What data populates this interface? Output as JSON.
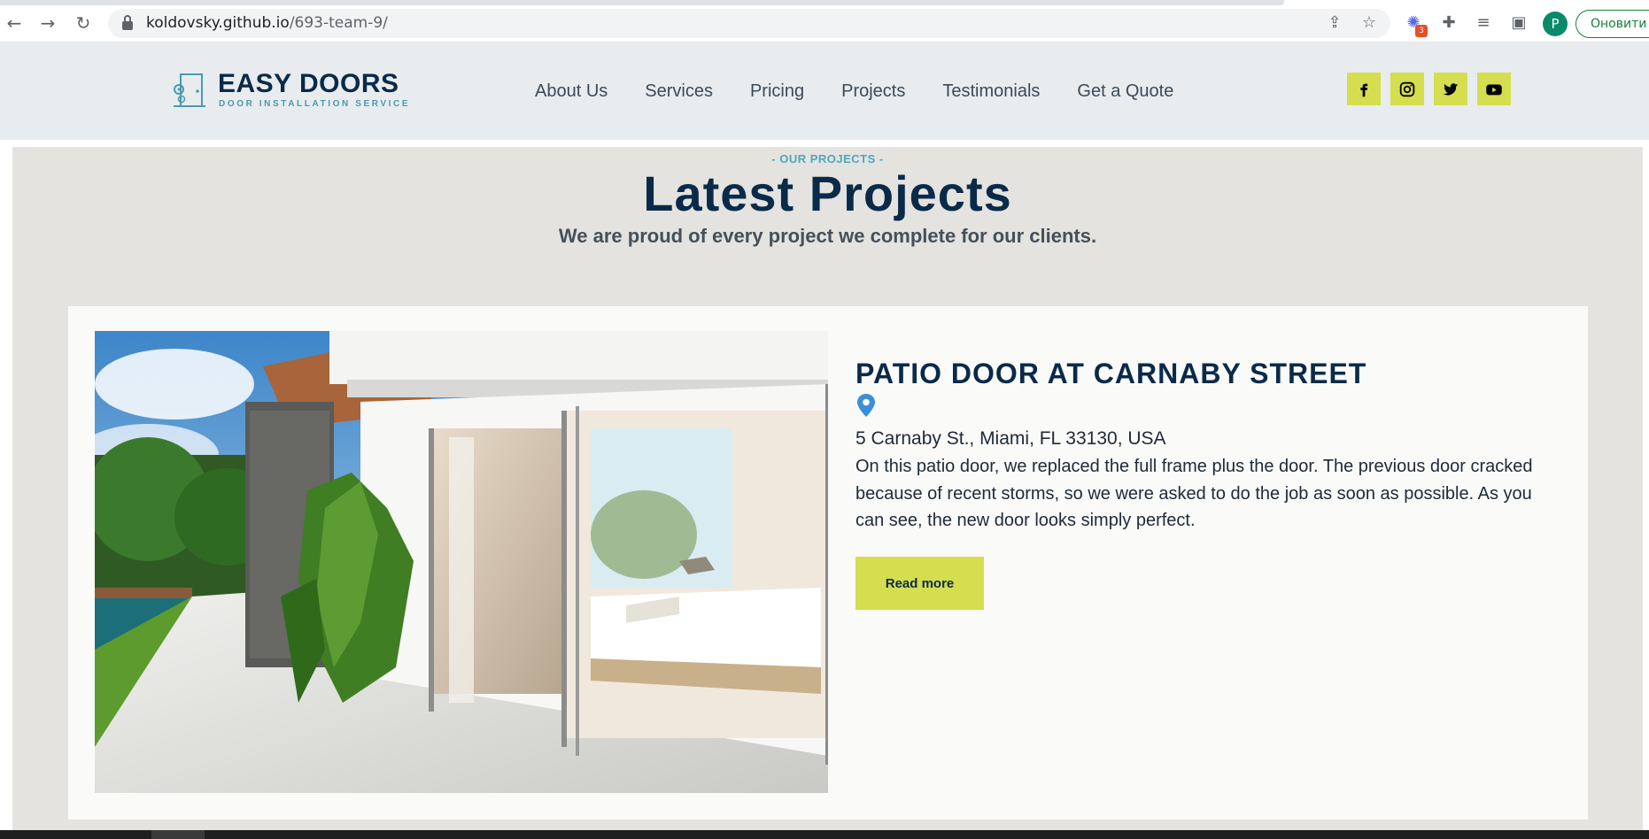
{
  "browser": {
    "url_host": "koldovsky.github.io",
    "url_path": "/693-team-9/",
    "extension_badge": "3",
    "profile_initial": "P",
    "update_label": "Оновити",
    "icons": [
      "back-icon",
      "forward-icon",
      "reload-icon",
      "lock-icon",
      "share-icon",
      "star-icon",
      "extension-icon",
      "puzzle-icon",
      "playlist-icon",
      "sidepanel-icon"
    ]
  },
  "header": {
    "logo_title": "EASY DOORS",
    "logo_subtitle": "DOOR INSTALLATION SERVICE",
    "menu": [
      "About Us",
      "Services",
      "Pricing",
      "Projects",
      "Testimonials",
      "Get a Quote"
    ],
    "socials": [
      "facebook-icon",
      "instagram-icon",
      "twitter-icon",
      "youtube-icon"
    ],
    "accent_color": "#d4de4e",
    "brand_color": "#0a2a4a"
  },
  "projects": {
    "eyebrow": "- OUR PROJECTS -",
    "title": "Latest Projects",
    "subtitle": "We are proud of every project we complete for our clients.",
    "card": {
      "title": "PATIO DOOR AT CARNABY STREET",
      "address": "5 Carnaby St., Miami, FL 33130, USA",
      "description": "On this patio door, we replaced the full frame plus the door. The previous door cracked because of recent storms, so we were asked to do the job as soon as possible. As you can see, the new door looks simply perfect.",
      "button": "Read more"
    }
  }
}
